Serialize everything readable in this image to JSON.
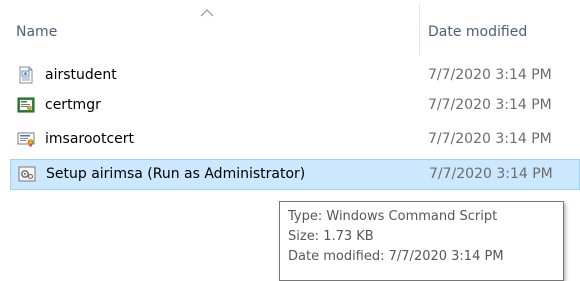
{
  "header": {
    "name_label": "Name",
    "date_label": "Date modified",
    "sort_icon": "chevron-up-icon"
  },
  "files": [
    {
      "name": "airstudent",
      "date": "7/7/2020 3:14 PM",
      "icon": "settings-file-icon",
      "selected": false
    },
    {
      "name": "certmgr",
      "date": "7/7/2020 3:14 PM",
      "icon": "certmgr-app-icon",
      "selected": false
    },
    {
      "name": "imsarootcert",
      "date": "7/7/2020 3:14 PM",
      "icon": "certificate-file-icon",
      "selected": false
    },
    {
      "name": "Setup airimsa (Run as Administrator)",
      "date": "7/7/2020 3:14 PM",
      "icon": "command-script-icon",
      "selected": true
    }
  ],
  "tooltip": {
    "type_line": "Type: Windows Command Script",
    "size_line": "Size: 1.73 KB",
    "date_line": "Date modified: 7/7/2020 3:14 PM"
  },
  "colors": {
    "selection_bg": "#cce8ff",
    "selection_border": "#99d1ff",
    "header_text": "#4c607a",
    "date_text": "#6d6d6d"
  }
}
